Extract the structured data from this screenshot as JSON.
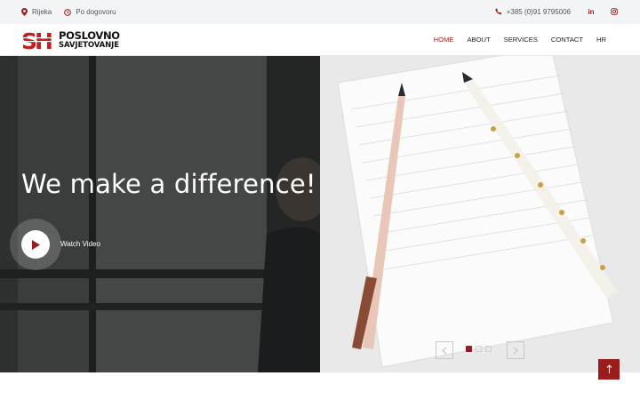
{
  "topbar": {
    "location": "Rijeka",
    "hours": "Po dogovoru",
    "phone": "+385 (0)91 9795006",
    "social": [
      {
        "icon": "linkedin-icon",
        "label": "in"
      },
      {
        "icon": "instagram-icon",
        "label": ""
      }
    ]
  },
  "logo": {
    "initials": "SH",
    "line1": "POSLOVNO",
    "line2": "SAVJETOVANJE"
  },
  "nav": {
    "items": [
      "HOME",
      "ABOUT",
      "SERVICES",
      "CONTACT",
      "HR"
    ],
    "active_index": 0
  },
  "hero": {
    "headline": "We make a difference!",
    "video_label": "Watch Video",
    "slides": {
      "count": 3,
      "active_index": 0
    }
  },
  "colors": {
    "accent": "#9b1c1c",
    "topbar_bg": "#f3f4f6"
  }
}
